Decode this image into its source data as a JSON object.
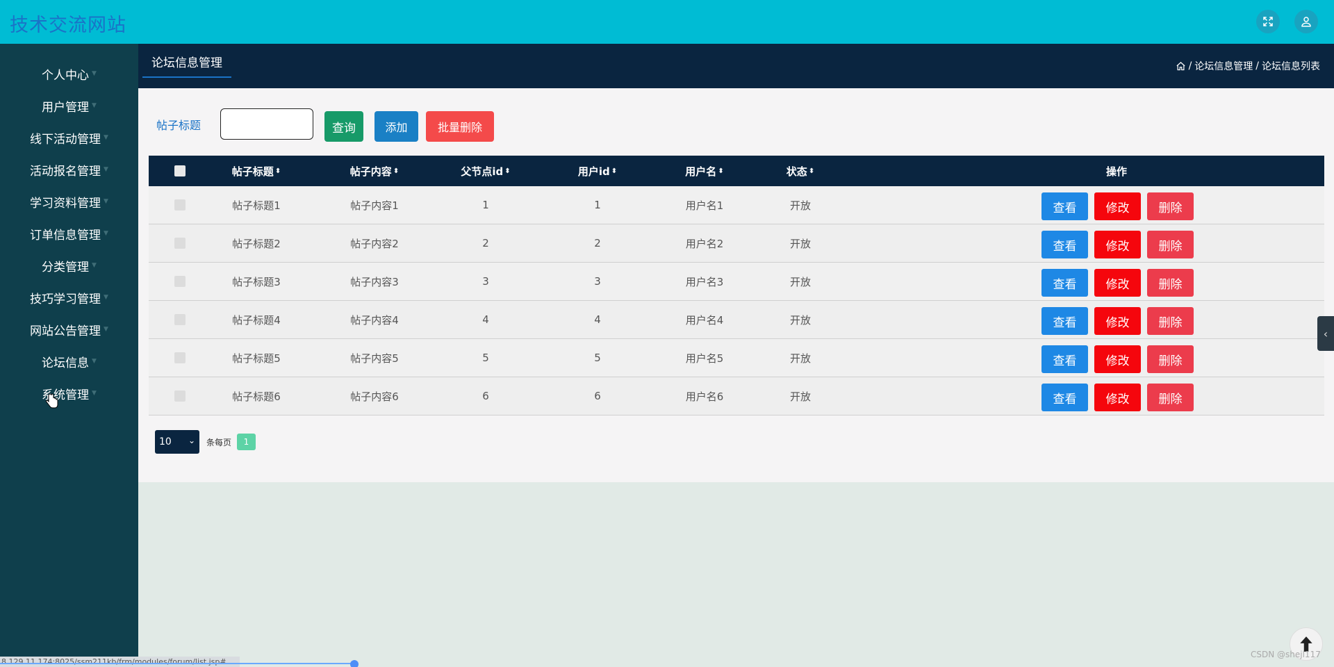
{
  "app": {
    "title": "技术交流网站",
    "fullscreen_icon": "fullscreen-icon",
    "user_icon": "user-icon"
  },
  "sidebar": {
    "items": [
      {
        "label": "个人中心"
      },
      {
        "label": "用户管理"
      },
      {
        "label": "线下活动管理"
      },
      {
        "label": "活动报名管理"
      },
      {
        "label": "学习资料管理"
      },
      {
        "label": "订单信息管理"
      },
      {
        "label": "分类管理"
      },
      {
        "label": "技巧学习管理"
      },
      {
        "label": "网站公告管理"
      },
      {
        "label": "论坛信息"
      },
      {
        "label": "系统管理"
      }
    ]
  },
  "header": {
    "tab": "论坛信息管理",
    "breadcrumb": [
      "论坛信息管理",
      "论坛信息列表"
    ],
    "breadcrumb_sep": "/"
  },
  "search": {
    "label": "帖子标题",
    "value": "",
    "query_label": "查询",
    "add_label": "添加",
    "batch_delete_label": "批量删除"
  },
  "table": {
    "columns": [
      "帖子标题",
      "帖子内容",
      "父节点id",
      "用户id",
      "用户名",
      "状态",
      "操作"
    ],
    "sort_glyph": "⬍",
    "rows": [
      {
        "title": "帖子标题1",
        "content": "帖子内容1",
        "parent_id": "1",
        "user_id": "1",
        "username": "用户名1",
        "status": "开放"
      },
      {
        "title": "帖子标题2",
        "content": "帖子内容2",
        "parent_id": "2",
        "user_id": "2",
        "username": "用户名2",
        "status": "开放"
      },
      {
        "title": "帖子标题3",
        "content": "帖子内容3",
        "parent_id": "3",
        "user_id": "3",
        "username": "用户名3",
        "status": "开放"
      },
      {
        "title": "帖子标题4",
        "content": "帖子内容4",
        "parent_id": "4",
        "user_id": "4",
        "username": "用户名4",
        "status": "开放"
      },
      {
        "title": "帖子标题5",
        "content": "帖子内容5",
        "parent_id": "5",
        "user_id": "5",
        "username": "用户名5",
        "status": "开放"
      },
      {
        "title": "帖子标题6",
        "content": "帖子内容6",
        "parent_id": "6",
        "user_id": "6",
        "username": "用户名6",
        "status": "开放"
      }
    ],
    "actions": {
      "view": "查看",
      "edit": "修改",
      "delete": "删除"
    }
  },
  "pagination": {
    "page_size": "10",
    "per_page_label": "条每页",
    "current_page": "1"
  },
  "footer": {
    "watermark": "CSDN @shejl117",
    "status_url": "8.129.11.174:8025/ssm211kb/frm/modules/forum/list.jsp#"
  },
  "colors": {
    "topbar": "#00bcd4",
    "sidebar": "#0f3f4c",
    "header": "#0a2540",
    "view_button": "#1e88e5",
    "edit_button": "#f5060d",
    "delete_button": "#ec3c4c"
  }
}
